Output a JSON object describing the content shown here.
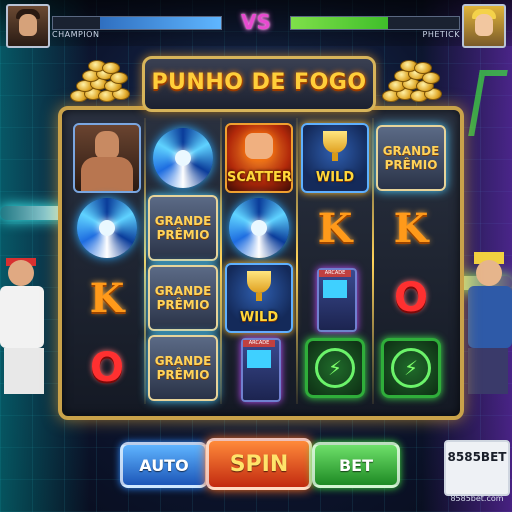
{
  "hud": {
    "player1": {
      "name": "CHAMPION",
      "health_fraction": 0.72
    },
    "player2": {
      "name": "PHETICK",
      "health_fraction": 0.58
    },
    "vs_label": "VS"
  },
  "game": {
    "title": "PUNHO DE FOGO"
  },
  "reels": [
    [
      {
        "type": "fighter",
        "icon": "fighter-portrait-icon"
      },
      {
        "type": "vortex",
        "icon": "blue-vortex-icon"
      },
      {
        "type": "letter",
        "text": "K",
        "icon": "letter-k-icon"
      },
      {
        "type": "letter-o",
        "text": "O",
        "icon": "letter-o-icon"
      }
    ],
    [
      {
        "type": "vortex",
        "icon": "blue-vortex-icon"
      },
      {
        "type": "grand",
        "line1": "GRANDE",
        "line2": "PRÊMIO"
      },
      {
        "type": "grand",
        "line1": "GRANDE",
        "line2": "PRÊMIO"
      },
      {
        "type": "grand",
        "line1": "GRANDE",
        "line2": "PRÊMIO"
      }
    ],
    [
      {
        "type": "scatter",
        "text": "SCATTER",
        "icon": "flaming-fist-icon"
      },
      {
        "type": "vortex",
        "icon": "blue-vortex-icon"
      },
      {
        "type": "wild",
        "text": "WILD",
        "icon": "trophy-icon"
      },
      {
        "type": "arcade",
        "text": "ARCADE",
        "icon": "arcade-cabinet-icon"
      }
    ],
    [
      {
        "type": "wild",
        "text": "WILD",
        "icon": "trophy-icon"
      },
      {
        "type": "letter",
        "text": "K",
        "icon": "letter-k-icon"
      },
      {
        "type": "arcade",
        "text": "ARCADE",
        "icon": "arcade-cabinet-icon"
      },
      {
        "type": "bolt",
        "icon": "lightning-bolt-icon"
      }
    ],
    [
      {
        "type": "grand",
        "line1": "GRANDE",
        "line2": "PRÊMIO"
      },
      {
        "type": "letter",
        "text": "K",
        "icon": "letter-k-icon"
      },
      {
        "type": "letter-o",
        "text": "O",
        "icon": "letter-o-icon"
      },
      {
        "type": "bolt",
        "icon": "lightning-bolt-icon"
      }
    ]
  ],
  "controls": {
    "auto_label": "AUTO",
    "spin_label": "SPIN",
    "bet_label": "BET"
  },
  "brand": {
    "name": "8585BET",
    "url": "8585bet.com"
  },
  "colors": {
    "title": "#ffce3a",
    "frame_gold": "#c9a24a",
    "auto": "#2f8cff",
    "spin": "#ff7020",
    "bet": "#3fdf3f"
  }
}
